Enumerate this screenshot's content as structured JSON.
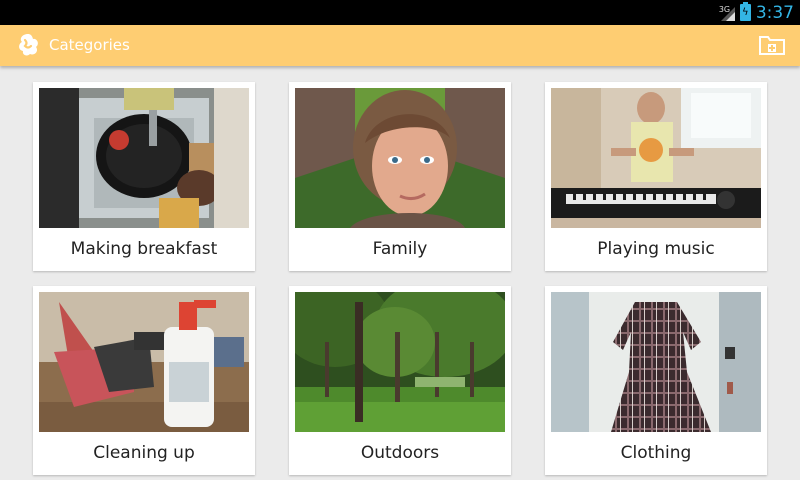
{
  "status_bar": {
    "network": "3G",
    "time": "3:37"
  },
  "action_bar": {
    "title": "Categories",
    "logo_icon": "app-logo-icon",
    "action_icon": "add-folder-icon"
  },
  "categories": [
    {
      "label": "Making breakfast",
      "image": "dish washing at sink"
    },
    {
      "label": "Family",
      "image": "woman portrait outdoors"
    },
    {
      "label": "Playing music",
      "image": "man playing keyboard"
    },
    {
      "label": "Cleaning up",
      "image": "dustpan, brush and spray bottle"
    },
    {
      "label": "Outdoors",
      "image": "park with trees"
    },
    {
      "label": "Clothing",
      "image": "plaid dress hanging on door"
    }
  ],
  "colors": {
    "action_bar": "#fecd72",
    "status_accent": "#33b5e5",
    "background": "#ebebeb"
  }
}
